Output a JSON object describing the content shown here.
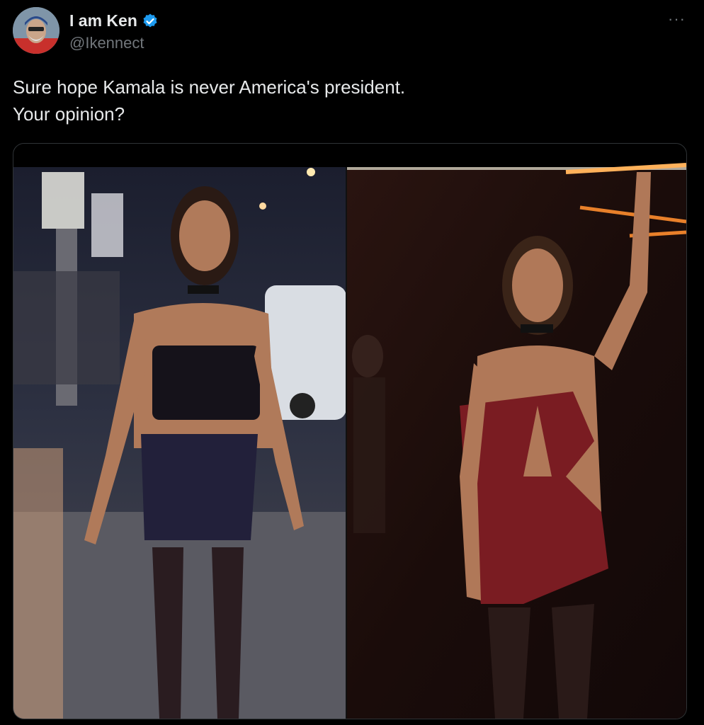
{
  "tweet": {
    "author": {
      "display_name": "I am Ken",
      "handle": "@Ikennect",
      "verified": true,
      "verified_icon": "verified-badge-icon",
      "avatar_icon": "profile-avatar"
    },
    "text_lines": [
      "Sure hope Kamala is never America's president.",
      "Your opinion?"
    ],
    "more_label": "···",
    "media": {
      "layout": "two-photo collage",
      "panels": [
        "left-photo",
        "right-photo"
      ]
    }
  },
  "colors": {
    "background": "#000000",
    "text": "#e7e9ea",
    "secondary": "#71767b",
    "verified": "#1d9bf0",
    "border": "#2f3336"
  }
}
